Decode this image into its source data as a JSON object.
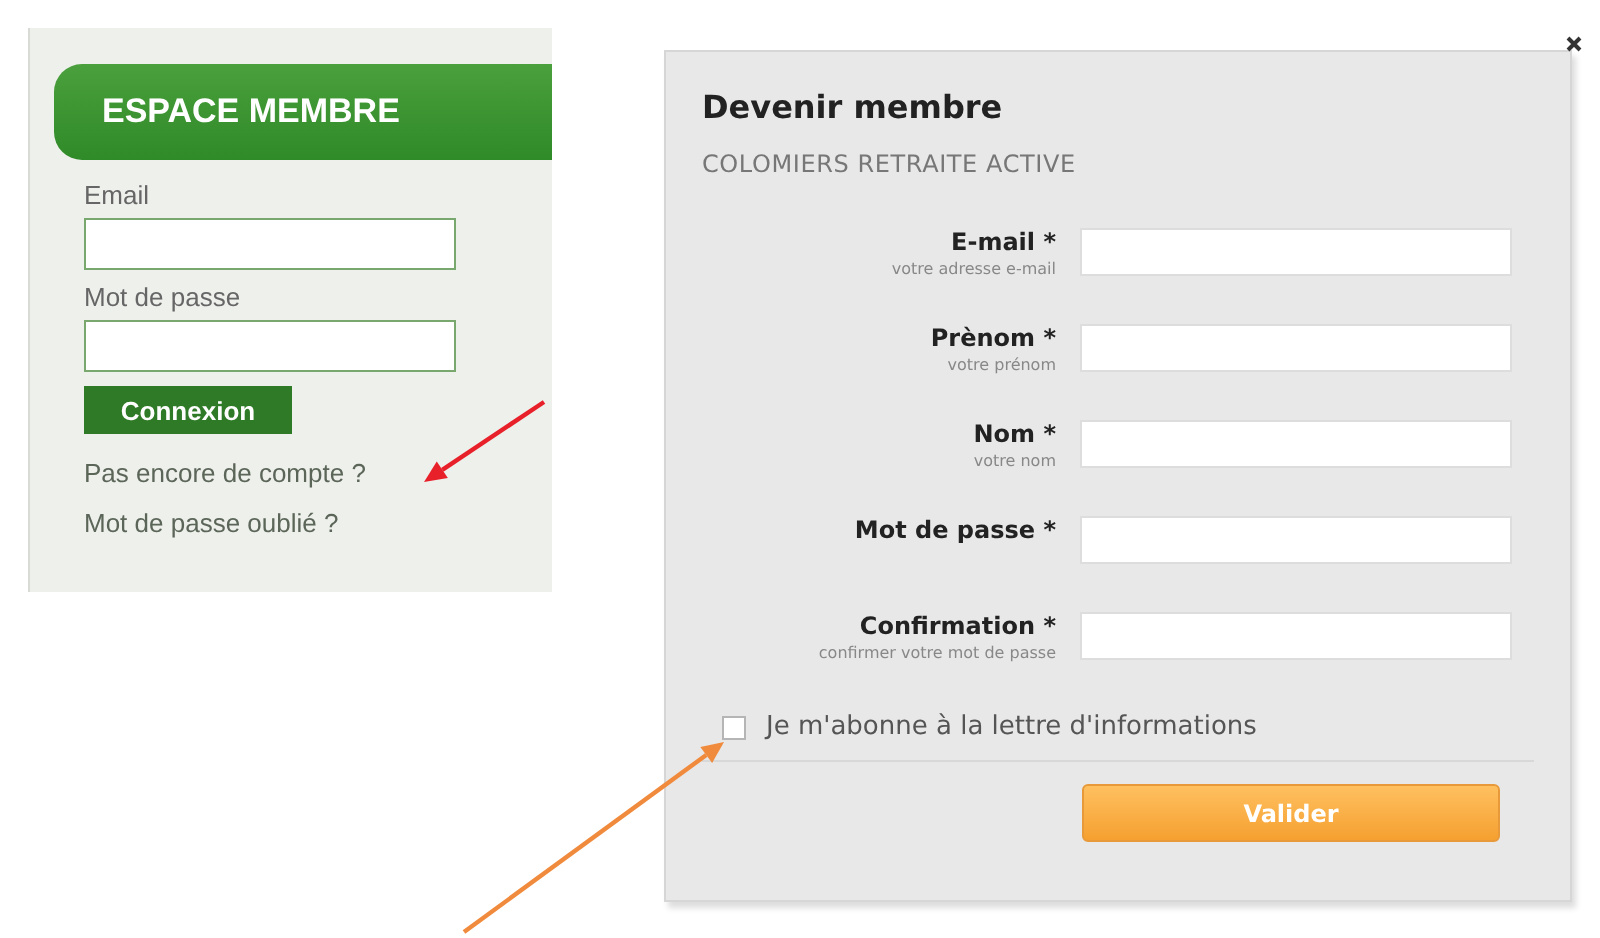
{
  "login_panel": {
    "title": "ESPACE MEMBRE",
    "fields": [
      {
        "label": "Email"
      },
      {
        "label": "Mot de passe"
      }
    ],
    "button": "Connexion",
    "links": [
      "Pas encore de compte ?",
      "Mot de passe oublié ?"
    ]
  },
  "signup_dialog": {
    "title": "Devenir membre",
    "subtitle": "COLOMIERS RETRAITE ACTIVE",
    "fields": [
      {
        "label": "E-mail *",
        "hint": "votre adresse e-mail"
      },
      {
        "label": "Prènom *",
        "hint": "votre prénom"
      },
      {
        "label": "Nom *",
        "hint": "votre nom"
      },
      {
        "label": "Mot de passe *"
      },
      {
        "label": "Confirmation *",
        "hint": "confirmer votre mot de passe"
      }
    ],
    "newsletter": {
      "label": "Je m'abonne à la lettre d'informations",
      "checked": false
    },
    "button": "Valider"
  },
  "annotations": [
    {
      "color": "#e8202a"
    },
    {
      "color": "#f08a3c"
    }
  ]
}
